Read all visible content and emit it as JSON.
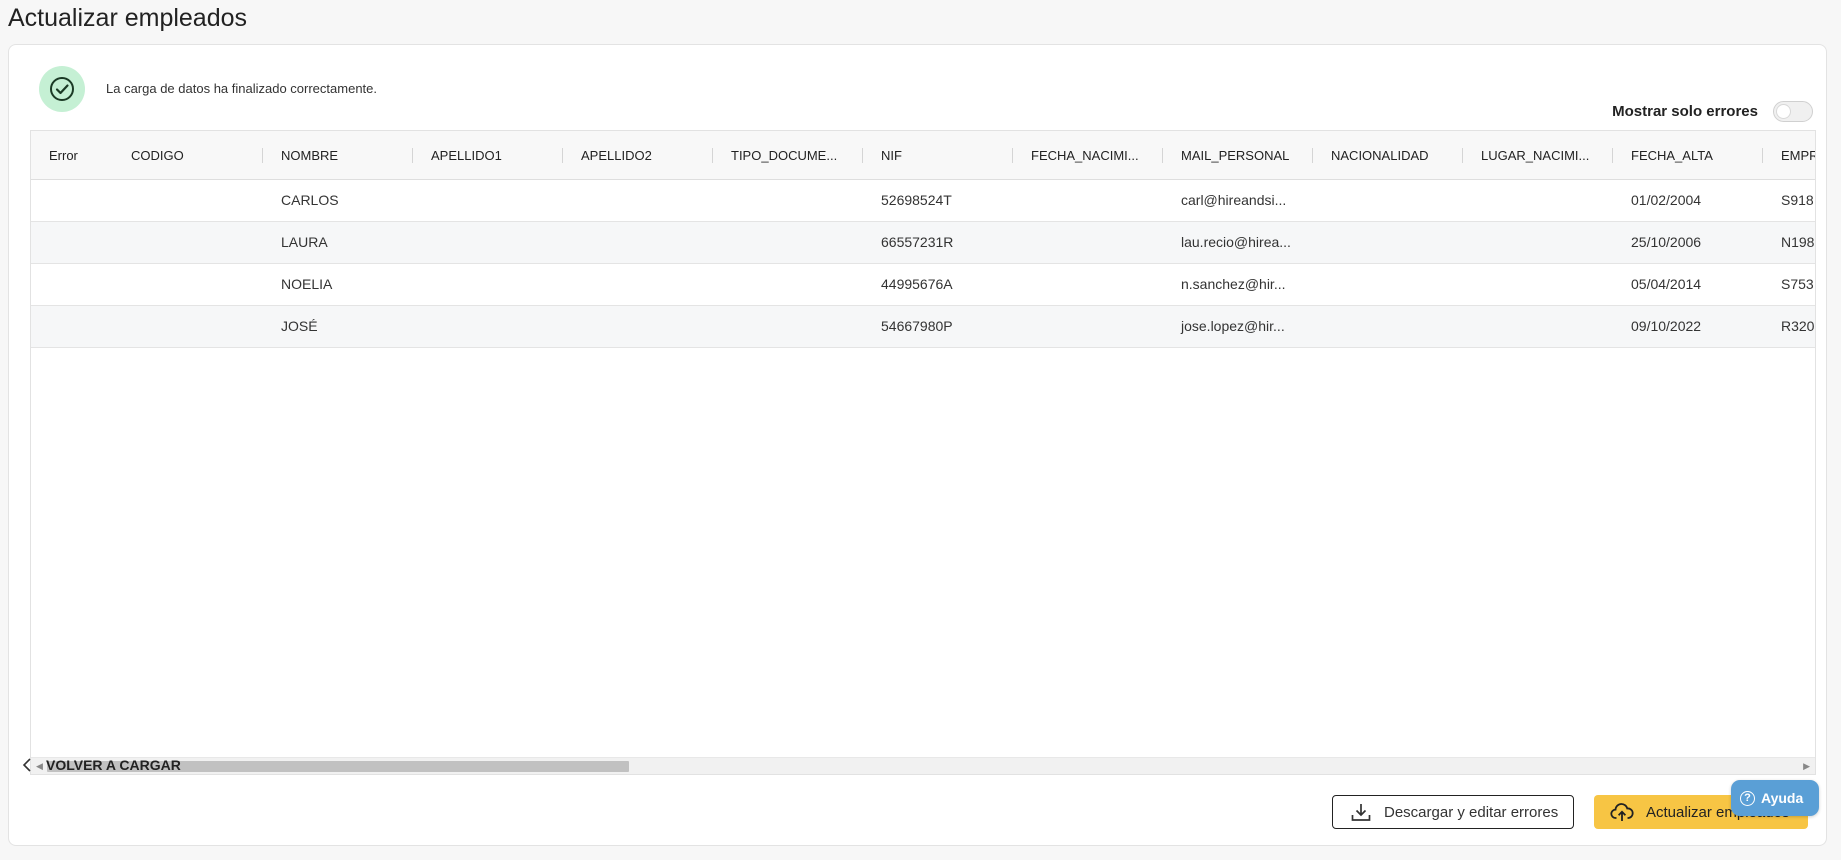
{
  "page": {
    "title": "Actualizar empleados"
  },
  "status": {
    "message": "La carga de datos ha finalizado correctamente.",
    "icon": "check-circle-icon",
    "color": "#c5f0d4"
  },
  "filter": {
    "label": "Mostrar solo errores",
    "enabled": false
  },
  "grid": {
    "columns": [
      "Error",
      "CODIGO",
      "NOMBRE",
      "APELLIDO1",
      "APELLIDO2",
      "TIPO_DOCUME...",
      "NIF",
      "FECHA_NACIMI...",
      "MAIL_PERSONAL",
      "NACIONALIDAD",
      "LUGAR_NACIMI...",
      "FECHA_ALTA",
      "EMPR"
    ],
    "rows": [
      [
        "",
        "",
        "CARLOS",
        "",
        "",
        "",
        "52698524T",
        "",
        "carl@hireandsi...",
        "",
        "",
        "01/02/2004",
        "S918"
      ],
      [
        "",
        "",
        "LAURA",
        "",
        "",
        "",
        "66557231R",
        "",
        "lau.recio@hirea...",
        "",
        "",
        "25/10/2006",
        "N198"
      ],
      [
        "",
        "",
        "NOELIA",
        "",
        "",
        "",
        "44995676A",
        "",
        "n.sanchez@hir...",
        "",
        "",
        "05/04/2014",
        "S753"
      ],
      [
        "",
        "",
        "JOSÉ",
        "",
        "",
        "",
        "54667980P",
        "",
        "jose.lopez@hir...",
        "",
        "",
        "09/10/2022",
        "R320"
      ]
    ]
  },
  "footer": {
    "back_label": "VOLVER A CARGAR",
    "download_label": "Descargar y editar errores",
    "update_label": "Actualizar empleados",
    "accent": "#f7c544"
  },
  "help": {
    "label": "Ayuda",
    "color": "#5a9fd6"
  }
}
